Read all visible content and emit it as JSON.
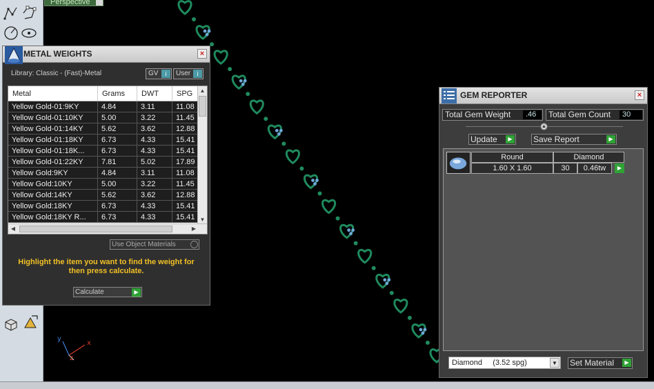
{
  "viewport": {
    "tab_label": "Perspective"
  },
  "metal_weights": {
    "title": "METAL WEIGHTS",
    "library": "Library: Classic - (Fast)-Metal",
    "chip_gv": "GV",
    "chip_user": "User",
    "columns": [
      "Metal",
      "Grams",
      "DWT",
      "SPG"
    ],
    "rows": [
      [
        "Yellow Gold-01:9KY",
        "4.84",
        "3.11",
        "11.08"
      ],
      [
        "Yellow Gold-01:10KY",
        "5.00",
        "3.22",
        "11.45"
      ],
      [
        "Yellow Gold-01:14KY",
        "5.62",
        "3.62",
        "12.88"
      ],
      [
        "Yellow Gold-01:18KY",
        "6.73",
        "4.33",
        "15.41"
      ],
      [
        "Yellow Gold-01:18K...",
        "6.73",
        "4.33",
        "15.41"
      ],
      [
        "Yellow Gold-01:22KY",
        "7.81",
        "5.02",
        "17.89"
      ],
      [
        "Yellow Gold:9KY",
        "4.84",
        "3.11",
        "11.08"
      ],
      [
        "Yellow Gold:10KY",
        "5.00",
        "3.22",
        "11.45"
      ],
      [
        "Yellow Gold:14KY",
        "5.62",
        "3.62",
        "12.88"
      ],
      [
        "Yellow Gold:18KY",
        "6.73",
        "4.33",
        "15.41"
      ],
      [
        "Yellow Gold:18KY R...",
        "6.73",
        "4.33",
        "15.41"
      ]
    ],
    "use_object_materials": "Use Object Materials",
    "message": "Highlight the item you want to find the weight for then press calculate.",
    "calculate_label": "Calculate"
  },
  "gem_reporter": {
    "title": "GEM REPORTER",
    "total_weight_label": "Total Gem Weight",
    "total_weight_value": ".46",
    "total_count_label": "Total Gem Count",
    "total_count_value": "30",
    "update_label": "Update",
    "save_report_label": "Save Report",
    "gem": {
      "shape": "Round",
      "type": "Diamond",
      "size": "1.60 X 1.60",
      "count": "30",
      "weight": "0.46tw"
    },
    "material_select": "Diamond     (3.52 spg)",
    "set_material_label": "Set Material"
  },
  "colors": {
    "panel": "#3b3b3b",
    "chain_green": "#1f8a5e",
    "gem_blue": "#6ea7d8",
    "accent_green": "#2fa236",
    "message_yellow": "#f2c024"
  }
}
